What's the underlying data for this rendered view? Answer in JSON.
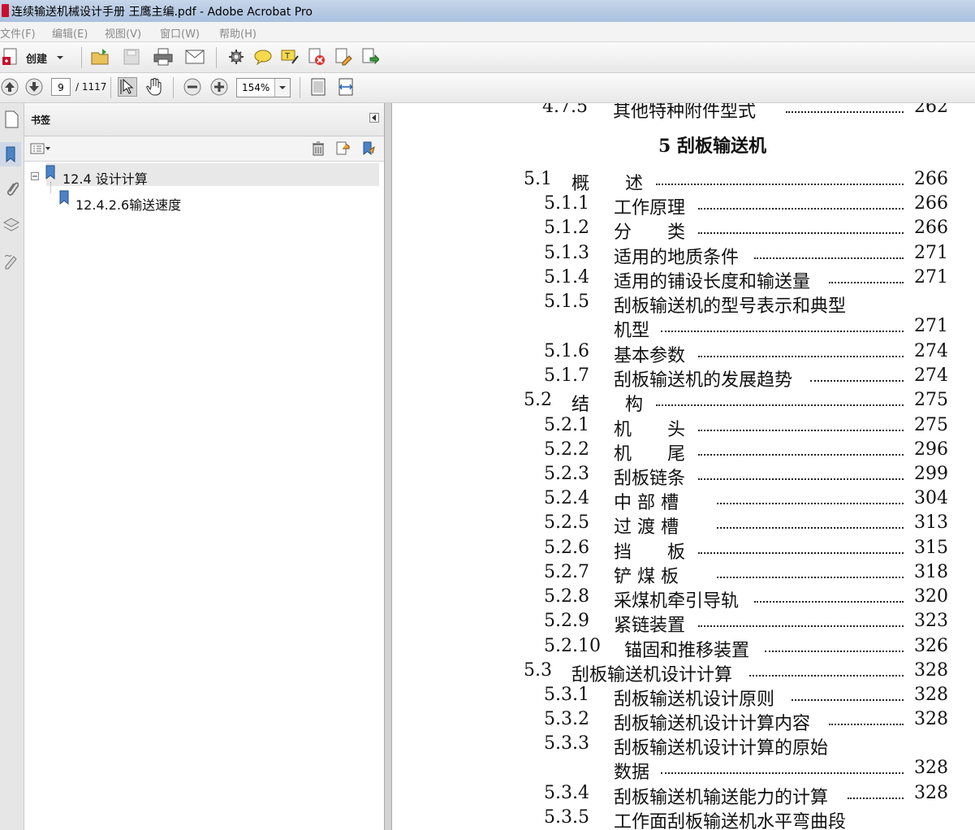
{
  "window": {
    "title": "连续输送机械设计手册 王鹰主编.pdf - Adobe Acrobat Pro"
  },
  "menu": [
    "文件(F)",
    "编辑(E)",
    "视图(V)",
    "窗口(W)",
    "帮助(H)"
  ],
  "toolbar": {
    "create_label": "创建"
  },
  "nav": {
    "current_page": "9",
    "total_pages": "/ 1117",
    "zoom": "154%"
  },
  "bookmarks_panel": {
    "header": "书签",
    "items": [
      {
        "label": "12.4 设计计算"
      },
      {
        "label": "12.4.2.6输送速度"
      }
    ]
  },
  "document": {
    "top_cut_entry": {
      "num": "4.7.5",
      "title": "其他特种附件型式",
      "page": "262"
    },
    "chapter_title": "5 刮板输送机",
    "entries": [
      {
        "num": "5.1",
        "title": "概　　述",
        "page": "266"
      },
      {
        "num": "5.1.1",
        "title": "工作原理",
        "page": "266"
      },
      {
        "num": "5.1.2",
        "title": "分　　类",
        "page": "266"
      },
      {
        "num": "5.1.3",
        "title": "适用的地质条件",
        "page": "271"
      },
      {
        "num": "5.1.4",
        "title": "适用的铺设长度和输送量",
        "page": "271"
      },
      {
        "num": "5.1.5",
        "title": "刮板输送机的型号表示和典型",
        "page": ""
      },
      {
        "num": "",
        "title": "机型",
        "page": "271"
      },
      {
        "num": "5.1.6",
        "title": "基本参数",
        "page": "274"
      },
      {
        "num": "5.1.7",
        "title": "刮板输送机的发展趋势",
        "page": "274"
      },
      {
        "num": "5.2",
        "title": "结　　构",
        "page": "275"
      },
      {
        "num": "5.2.1",
        "title": "机　　头",
        "page": "275"
      },
      {
        "num": "5.2.2",
        "title": "机　　尾",
        "page": "296"
      },
      {
        "num": "5.2.3",
        "title": "刮板链条",
        "page": "299"
      },
      {
        "num": "5.2.4",
        "title": "中 部 槽",
        "page": "304"
      },
      {
        "num": "5.2.5",
        "title": "过 渡 槽",
        "page": "313"
      },
      {
        "num": "5.2.6",
        "title": "挡　　板",
        "page": "315"
      },
      {
        "num": "5.2.7",
        "title": "铲 煤 板",
        "page": "318"
      },
      {
        "num": "5.2.8",
        "title": "采煤机牵引导轨",
        "page": "320"
      },
      {
        "num": "5.2.9",
        "title": "紧链装置",
        "page": "323"
      },
      {
        "num": "5.2.10",
        "title": "锚固和推移装置",
        "page": "326"
      },
      {
        "num": "5.3",
        "title": "刮板输送机设计计算",
        "page": "328"
      },
      {
        "num": "5.3.1",
        "title": "刮板输送机设计原则",
        "page": "328"
      },
      {
        "num": "5.3.2",
        "title": "刮板输送机设计计算内容",
        "page": "328"
      },
      {
        "num": "5.3.3",
        "title": "刮板输送机设计计算的原始",
        "page": ""
      },
      {
        "num": "",
        "title": "数据",
        "page": "328"
      },
      {
        "num": "5.3.4",
        "title": "刮板输送机输送能力的计算",
        "page": "328"
      },
      {
        "num": "5.3.5",
        "title": "工作面刮板输送机水平弯曲段",
        "page": ""
      }
    ]
  }
}
